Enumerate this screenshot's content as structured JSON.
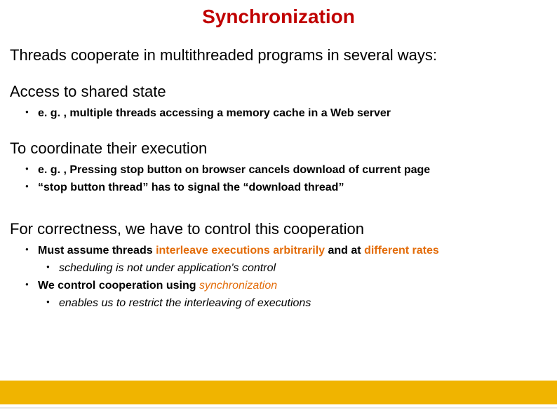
{
  "title": "Synchronization",
  "intro": "Threads cooperate in multithreaded programs in several ways:",
  "s1": {
    "heading": "Access to shared state",
    "b1": "e. g. , multiple threads accessing a memory cache in a Web server"
  },
  "s2": {
    "heading": "To coordinate their execution",
    "b1": "e. g. , Pressing stop button on browser cancels download of current page",
    "b2": "“stop button thread” has to signal the “download thread”"
  },
  "s3": {
    "heading": "For correctness, we have to control this cooperation",
    "b1_pre": "Must assume threads ",
    "b1_h1": "interleave executions arbitrarily",
    "b1_mid": " and at ",
    "b1_h2": "different rates",
    "b1_sub1": "scheduling is not under application's control",
    "b2_pre": "We control cooperation using ",
    "b2_h": "synchronization",
    "b2_sub1": "enables us to restrict the interleaving of executions"
  }
}
